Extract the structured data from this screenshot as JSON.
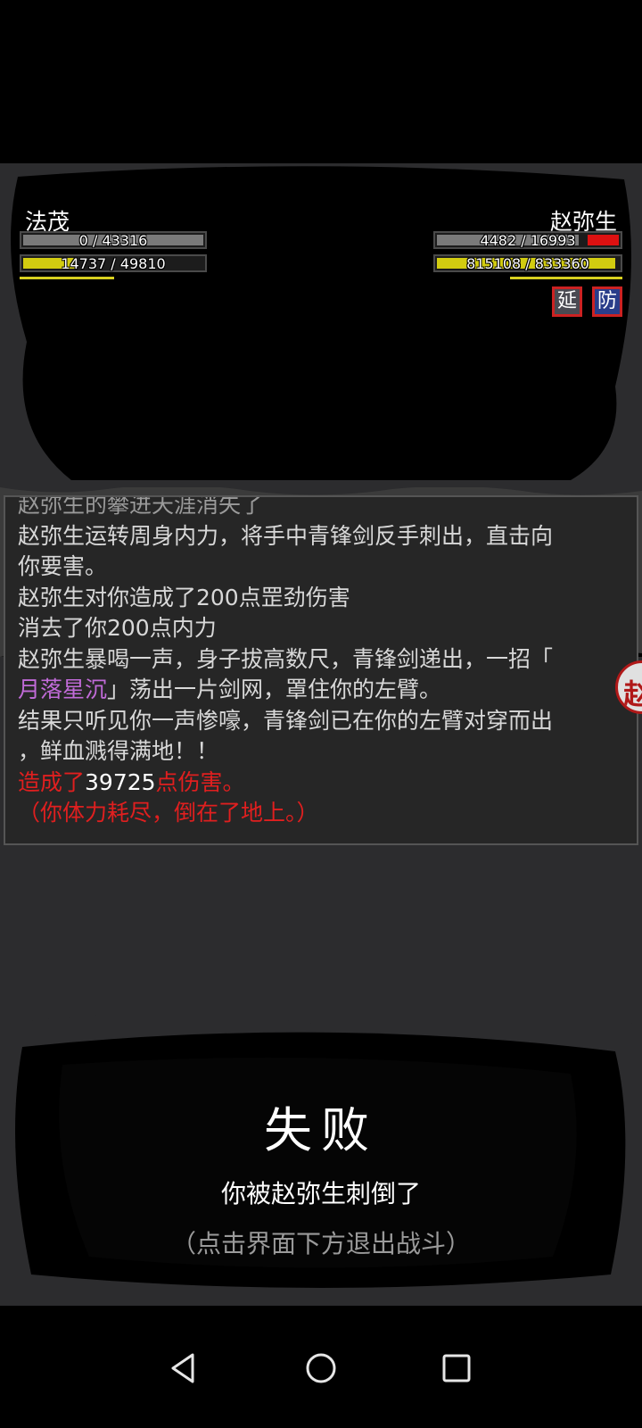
{
  "player": {
    "name": "法茂",
    "hp_text": "0 / 43316",
    "hp_fraction": 0.0,
    "mp_text": "14737 / 49810",
    "mp_fraction": 0.296
  },
  "enemy": {
    "name": "赵弥生",
    "hp_text": "4482 / 16993",
    "hp_fraction": 0.264,
    "mp_text": "815108 / 833360",
    "mp_fraction": 0.978,
    "status_icons": [
      {
        "label": "延",
        "name": "delay-status-icon"
      },
      {
        "label": "防",
        "name": "defend-status-icon"
      }
    ]
  },
  "battle_log": {
    "line1": "赵弥生的攀进天涯消失了",
    "line2": "赵弥生运转周身内力，将手中青锋剑反手刺出，直击向",
    "line3": "你要害。",
    "line4": "赵弥生对你造成了200点罡劲伤害",
    "line5": "消去了你200点内力",
    "line6": "赵弥生暴喝一声，身子拔高数尺，青锋剑递出，一招「",
    "line7_skill": "月落星沉",
    "line7_rest": "」荡出一片剑网，罩住你的左臂。",
    "line8": "结果只听见你一声惨嚎，青锋剑已在你的左臂对穿而出",
    "line9": "，鲜血溅得满地！！",
    "line10_a": "造成了",
    "line10_num": "39725",
    "line10_b": "点伤害。",
    "line11_a": "（",
    "line11_b": "你体力耗尽，倒在了地上。",
    "line11_c": "）"
  },
  "side_button": {
    "label": "赵"
  },
  "result": {
    "title": "失败",
    "message": "你被赵弥生刺倒了",
    "hint": "（点击界面下方退出战斗）"
  },
  "colors": {
    "hp_bar": "#7a7a7a",
    "mp_bar": "#d2cc10",
    "damage_red": "#e01f1f",
    "skill_purple": "#c16bd8"
  },
  "navbar": {
    "back": "back-icon",
    "home": "home-icon",
    "recent": "recent-apps-icon"
  }
}
